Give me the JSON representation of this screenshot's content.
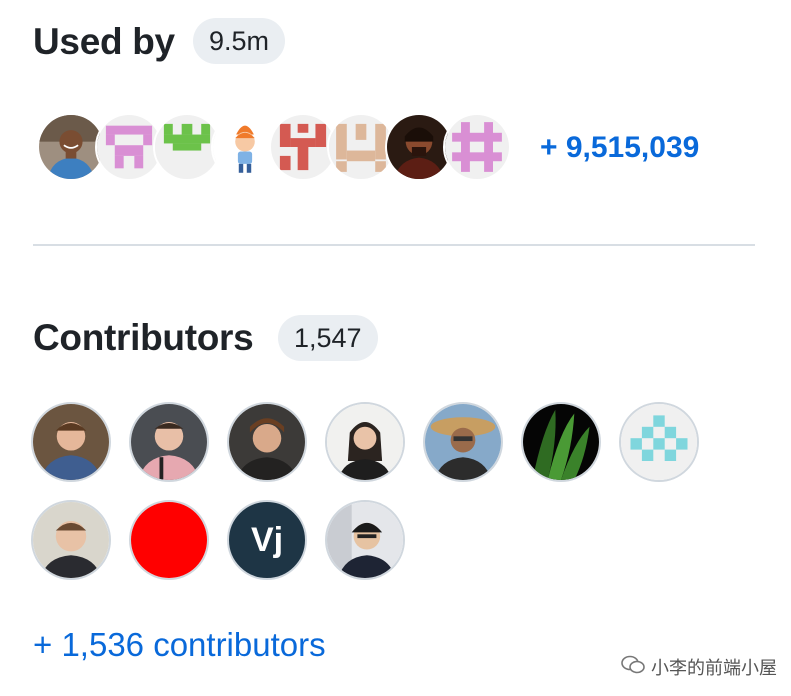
{
  "used_by": {
    "title": "Used by",
    "count": "9.5m",
    "more_label": "+ 9,515,039",
    "avatars": [
      {
        "name": "user-photo-man-smiling",
        "icon": "avatar-photo"
      },
      {
        "name": "identicon-pink",
        "icon": "identicon"
      },
      {
        "name": "identicon-green",
        "icon": "identicon"
      },
      {
        "name": "cartoon-avatar",
        "icon": "avatar-illustration"
      },
      {
        "name": "identicon-red",
        "icon": "identicon"
      },
      {
        "name": "identicon-tan",
        "icon": "identicon"
      },
      {
        "name": "user-photo-dark",
        "icon": "avatar-photo"
      },
      {
        "name": "identicon-violet",
        "icon": "identicon"
      }
    ]
  },
  "contributors": {
    "title": "Contributors",
    "count": "1,547",
    "more_label": "+ 1,536 contributors",
    "avatars": [
      {
        "name": "contributor-1",
        "icon": "avatar-photo"
      },
      {
        "name": "contributor-2",
        "icon": "avatar-photo"
      },
      {
        "name": "contributor-3",
        "icon": "avatar-photo"
      },
      {
        "name": "contributor-4",
        "icon": "avatar-photo"
      },
      {
        "name": "contributor-5",
        "icon": "avatar-photo"
      },
      {
        "name": "contributor-6",
        "icon": "avatar-leaves"
      },
      {
        "name": "contributor-7",
        "icon": "identicon"
      },
      {
        "name": "contributor-8",
        "icon": "avatar-photo"
      },
      {
        "name": "contributor-9",
        "icon": "avatar-red-circle"
      },
      {
        "name": "contributor-10",
        "icon": "avatar-initials",
        "initials": "Vj"
      },
      {
        "name": "contributor-11",
        "icon": "avatar-photo"
      }
    ]
  },
  "watermark": {
    "text": "小李的前端小屋"
  },
  "colors": {
    "link": "#0969da",
    "counter_bg": "#eaeef2",
    "divider": "#d8dee4",
    "vj_bg": "#1e3545",
    "red_avatar": "#ff0000"
  }
}
